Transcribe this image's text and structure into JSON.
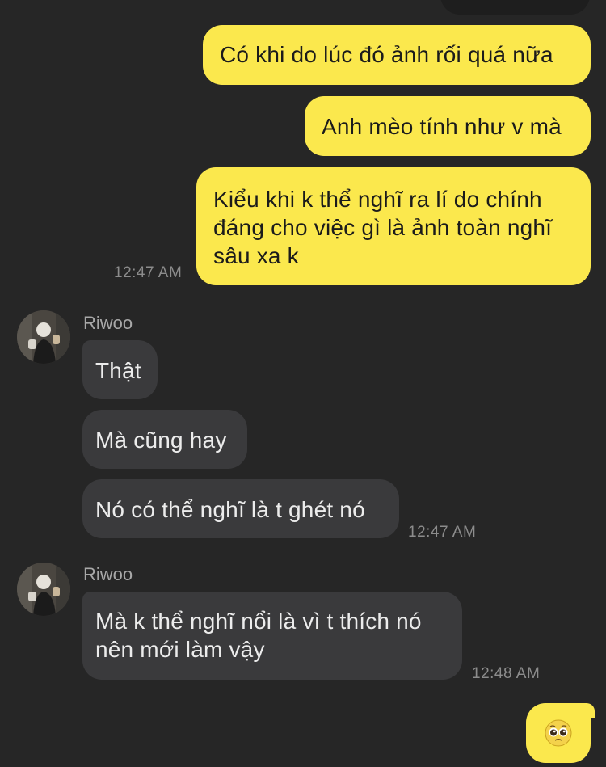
{
  "messages": {
    "out1": "Có khi do lúc đó ảnh rối quá nữa",
    "out2": "Anh mèo tính như v mà",
    "out3_line1": "Kiểu khi k thể nghĩ ra lí do chính",
    "out3_line2": "đáng cho việc gì là ảnh toàn nghĩ",
    "out3_line3": "sâu xa k",
    "time1": "12:47 AM",
    "sender1": "Riwoo",
    "in1": "Thật",
    "in2": "Mà cũng hay",
    "in3": "Nó có thể nghĩ là t ghét nó",
    "time2": "12:47 AM",
    "sender2": "Riwoo",
    "in4_line1": "Mà k thể nghĩ nổi là vì t thích nó",
    "in4_line2": "nên mới làm vậy",
    "time3": "12:48 AM",
    "emoji": "🥹"
  },
  "colors": {
    "background": "#262626",
    "outgoing_bubble": "#fbe84d",
    "incoming_bubble": "#3a3a3c"
  }
}
